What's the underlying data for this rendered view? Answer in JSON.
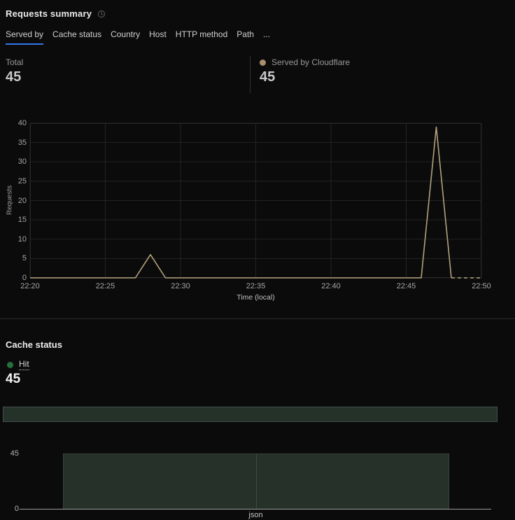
{
  "header": {
    "title": "Requests summary"
  },
  "tabs": {
    "items": [
      {
        "label": "Served by",
        "name": "served-by",
        "active": true
      },
      {
        "label": "Cache status",
        "name": "cache-status",
        "active": false
      },
      {
        "label": "Country",
        "name": "country",
        "active": false
      },
      {
        "label": "Host",
        "name": "host",
        "active": false
      },
      {
        "label": "HTTP method",
        "name": "http-method",
        "active": false
      },
      {
        "label": "Path",
        "name": "path",
        "active": false
      },
      {
        "label": "...",
        "name": "more",
        "active": false
      }
    ]
  },
  "metrics": {
    "total_label": "Total",
    "total_value": "45",
    "series_label": "Served by Cloudflare",
    "series_value": "45"
  },
  "cache_section": {
    "heading": "Cache status",
    "legend_label": "Hit",
    "legend_value": "45"
  },
  "colors": {
    "background": "#0b0b0c",
    "grid": "#232323",
    "plot_border": "#272727",
    "accent_blue": "#3377e8",
    "line_tan": "#b4a17c",
    "dot_tan": "#a98f6d",
    "hit_green": "#26703c",
    "bar_fill_green": "#263229",
    "bar_border_green": "#41514a",
    "axis_line": "#9c9c9c"
  },
  "chart_data": [
    {
      "type": "line",
      "title": "Requests over time",
      "xlabel": "Time (local)",
      "ylabel": "Requests",
      "xticks": [
        "22:20",
        "22:25",
        "22:30",
        "22:35",
        "22:40",
        "22:45",
        "22:50"
      ],
      "yticks": [
        0,
        5,
        10,
        15,
        20,
        25,
        30,
        35,
        40
      ],
      "ylim": [
        0,
        40
      ],
      "grid": true,
      "legend_position": "none",
      "series": [
        {
          "name": "Served by Cloudflare",
          "color": "#b4a17c",
          "points": [
            [
              "22:20",
              0
            ],
            [
              "22:27",
              0
            ],
            [
              "22:28",
              6
            ],
            [
              "22:29",
              0
            ],
            [
              "22:46",
              0
            ],
            [
              "22:47",
              39
            ],
            [
              "22:48",
              0
            ]
          ],
          "dashed_tail": [
            [
              "22:48",
              0
            ],
            [
              "22:50",
              0
            ]
          ]
        }
      ]
    },
    {
      "type": "bar",
      "title": "Cache status by content type",
      "categories": [
        "json"
      ],
      "values": [
        45
      ],
      "series_name": "Hit",
      "bar_color": "#263229",
      "ylim": [
        0,
        45
      ],
      "yticks": [
        0,
        45
      ],
      "grid": false
    },
    {
      "type": "stacked-bar-horizontal",
      "title": "Cache status distribution",
      "total": 45,
      "segments": [
        {
          "label": "Hit",
          "value": 45,
          "pct": 100,
          "color": "#253229"
        }
      ]
    }
  ]
}
